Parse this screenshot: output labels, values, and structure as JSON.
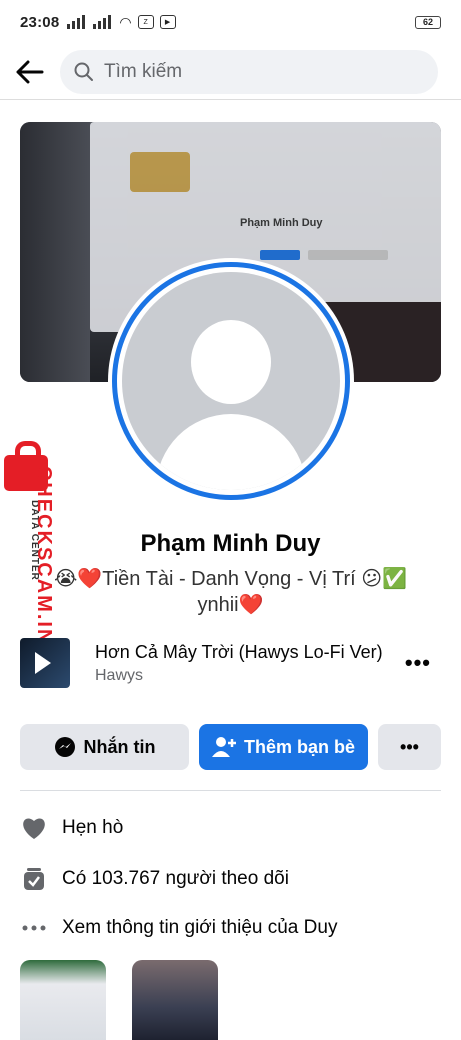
{
  "status_bar": {
    "time": "23:08",
    "battery": "62"
  },
  "search": {
    "placeholder": "Tìm kiếm"
  },
  "cover": {
    "title": "Phạm Minh Duy"
  },
  "profile": {
    "name": "Phạm Minh Duy",
    "bio_line1": "😭❤️Tiền Tài - Danh Vọng - Vị Trí 😕✅",
    "bio_line2": "ynhii❤️"
  },
  "music": {
    "song": "Hơn Cả Mây Trời (Hawys Lo-Fi Ver)",
    "artist": "Hawys",
    "more": "•••"
  },
  "actions": {
    "message": "Nhắn tin",
    "add_friend": "Thêm bạn bè",
    "more": "•••"
  },
  "info": {
    "dating": "Hẹn hò",
    "followers": "Có 103.767 người theo dõi",
    "about": "Xem thông tin giới thiệu của Duy"
  },
  "watermark": {
    "brand": "CHECKSCAM.INFO",
    "tag": "DATA CENTER"
  },
  "accent": "#1b74e4",
  "icons": [
    "back-arrow-icon",
    "search-icon",
    "messenger-icon",
    "add-friend-icon",
    "heart-icon",
    "followers-icon",
    "more-dots-icon",
    "play-icon",
    "lock-icon"
  ]
}
